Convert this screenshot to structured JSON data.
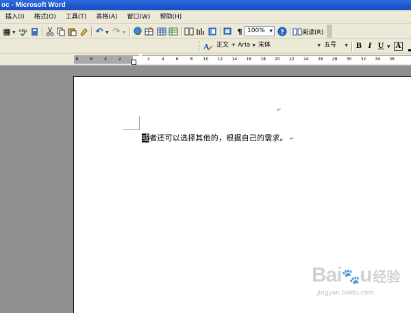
{
  "window": {
    "title": "oc - Microsoft Word"
  },
  "menu": [
    {
      "name": "insert",
      "label": "插入(I)"
    },
    {
      "name": "format",
      "label": "格式(O)"
    },
    {
      "name": "tools",
      "label": "工具(T)"
    },
    {
      "name": "table",
      "label": "表格(A)"
    },
    {
      "name": "window",
      "label": "窗口(W)"
    },
    {
      "name": "help",
      "label": "帮助(H)"
    }
  ],
  "toolbar": {
    "zoom": "100%",
    "read_button_label": "阅读(R)"
  },
  "formatting": {
    "style": "正文 + Aria",
    "font": "宋体",
    "size": "五号",
    "bold": "B",
    "italic": "I",
    "underline": "U",
    "char_border": "A"
  },
  "ruler": {
    "numbers": [
      "8",
      "6",
      "4",
      "2",
      "2",
      "4",
      "6",
      "8",
      "10",
      "12",
      "14",
      "16",
      "18",
      "20",
      "22",
      "24",
      "26",
      "28",
      "30",
      "32",
      "34",
      "36"
    ]
  },
  "document": {
    "selected_char": "或",
    "text_rest": "者还可以选择其他的，根据自己的需求。",
    "paragraph_mark": "↵"
  },
  "watermark": {
    "logo": "Bai",
    "paw": "🐾",
    "logo_end": "u",
    "cn": "经验",
    "url": "jingyan.baidu.com"
  }
}
